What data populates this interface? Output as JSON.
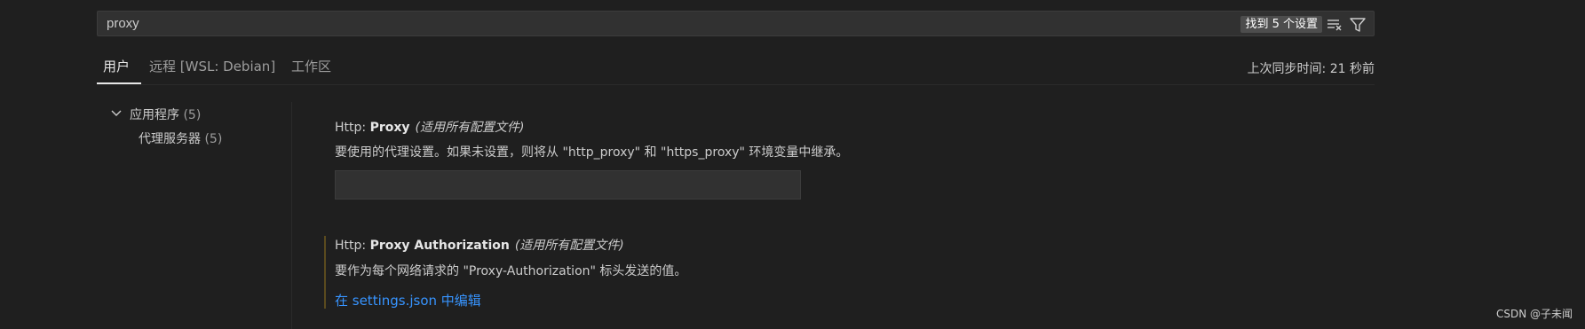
{
  "search": {
    "value": "proxy",
    "result_count_label": "找到 5 个设置",
    "clear_filter_icon": "clear-filter-icon",
    "filter_icon": "filter-icon"
  },
  "tabs": [
    {
      "label": "用户",
      "active": true
    },
    {
      "label": "远程 [WSL: Debian]",
      "active": false
    },
    {
      "label": "工作区",
      "active": false
    }
  ],
  "sync_status": "上次同步时间: 21 秒前",
  "toc": {
    "group_label": "应用程序",
    "group_count": "(5)",
    "child_label": "代理服务器",
    "child_count": "(5)"
  },
  "settings": [
    {
      "prefix": "Http: ",
      "name": "Proxy",
      "scope": "(适用所有配置文件)",
      "description": "要使用的代理设置。如果未设置，则将从 \"http_proxy\" 和 \"https_proxy\" 环境变量中继承。",
      "value": ""
    },
    {
      "prefix": "Http: ",
      "name": "Proxy Authorization",
      "scope": "(适用所有配置文件)",
      "description": "要作为每个网络请求的 \"Proxy-Authorization\" 标头发送的值。",
      "edit_link": "在 settings.json 中编辑"
    }
  ],
  "watermark": "CSDN @子未闻",
  "colors": {
    "background": "#1f1f1f",
    "link": "#3794ff",
    "modified_indicator": "#5a4a1e"
  }
}
